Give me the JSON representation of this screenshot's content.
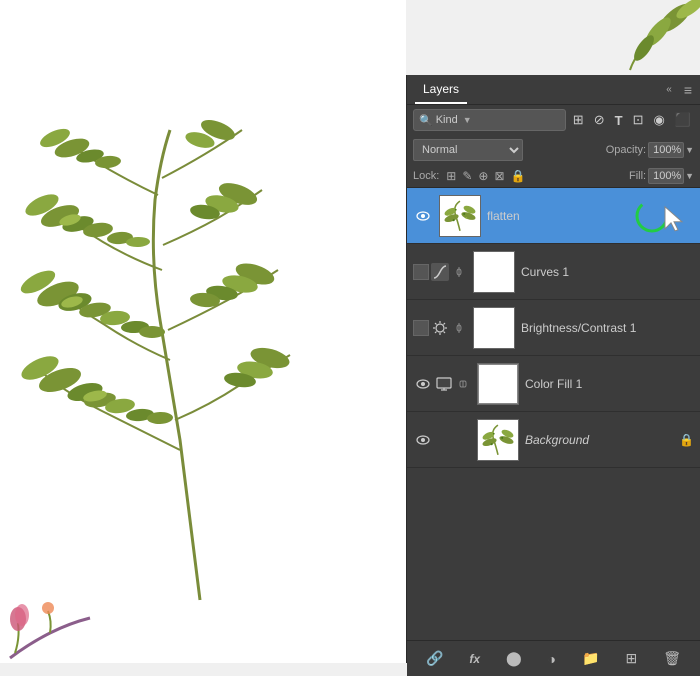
{
  "panel": {
    "title": "Layers",
    "menu_icon": "≡",
    "arrows": "«",
    "filter_label": "Kind",
    "blend_mode": "Normal",
    "opacity_label": "Opacity:",
    "opacity_value": "100%",
    "fill_label": "Fill:",
    "fill_value": "100%",
    "lock_label": "Lock:",
    "toolbar_icons": [
      "⊞",
      "✎",
      "⊕",
      "⊠",
      "🔒"
    ],
    "filter_icons": [
      "⊞",
      "⊘",
      "T",
      "⊡",
      "◉"
    ]
  },
  "layers": [
    {
      "id": "flatten",
      "name": "flatten",
      "visible": true,
      "has_thumb": true,
      "thumb_type": "leaf",
      "selected": true,
      "has_green_circle": true,
      "has_cursor": true,
      "has_checkbox": false,
      "adj_icon": null
    },
    {
      "id": "curves1",
      "name": "Curves 1",
      "visible": false,
      "has_thumb": true,
      "thumb_type": "white",
      "selected": false,
      "has_checkbox": true,
      "adj_icon": "curves"
    },
    {
      "id": "brightness1",
      "name": "Brightness/Contrast 1",
      "visible": false,
      "has_thumb": true,
      "thumb_type": "white",
      "selected": false,
      "has_checkbox": true,
      "adj_icon": "brightness"
    },
    {
      "id": "colorfill1",
      "name": "Color Fill 1",
      "visible": true,
      "has_thumb": true,
      "thumb_type": "white",
      "selected": false,
      "has_checkbox": false,
      "adj_icon": "monitor",
      "has_link": true
    },
    {
      "id": "background",
      "name": "Background",
      "visible": true,
      "has_thumb": true,
      "thumb_type": "leaf",
      "selected": false,
      "has_checkbox": false,
      "adj_icon": null,
      "has_lock": true,
      "name_style": "italic"
    }
  ],
  "bottom_icons": [
    "link",
    "fx",
    "mask",
    "adjust",
    "folder",
    "new",
    "delete"
  ],
  "bottom_icon_chars": [
    "🔗",
    "fx",
    "⊙",
    "⊘",
    "📁",
    "⊞",
    "🗑"
  ]
}
